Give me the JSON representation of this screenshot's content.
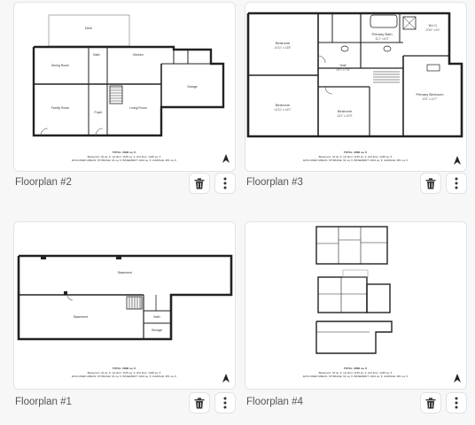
{
  "cards": [
    {
      "caption": "Floorplan #2",
      "plan_labels": [
        "Deck",
        "Dining Room",
        "Kitchen",
        "Bath",
        "Family Room",
        "Foyer",
        "Living Room",
        "Garage"
      ],
      "footer_title": "TOTAL: 2808 sq. ft",
      "footer_lines": [
        "Basement: 44 sq. ft, 1st floor: 1125 sq. ft, 2nd floor: 1235 sq. ft",
        "EXCLUDED AREAS: STORAGE: 61 sq. ft, BASEMENT: 1044 sq. ft, GARAGE: 481 sq. ft"
      ]
    },
    {
      "caption": "Floorplan #3",
      "plan_labels": [
        "Bedroom",
        "Primary Bath",
        "W.I.C.",
        "Hall",
        "Bedroom",
        "Bedroom",
        "Primary Bedroom"
      ],
      "plan_dims": [
        "14'11\" x 13'8\"",
        "11'1\" x 8'3\"",
        "8'10\" x 6'1\"",
        "19'1\" x 7'6\"",
        "14'11\" x 14'0\"",
        "13'1\" x 10'9\"",
        "13'3\" x 21'7\""
      ],
      "footer_title": "TOTAL: 2808 sq. ft",
      "footer_lines": [
        "Basement: 44 sq. ft, 1st floor: 1125 sq. ft, 2nd floor: 1235 sq. ft",
        "EXCLUDED AREAS: STORAGE: 61 sq. ft, BASEMENT: 1044 sq. ft, GARAGE: 481 sq. ft"
      ]
    },
    {
      "caption": "Floorplan #1",
      "plan_labels": [
        "Basement",
        "Basement",
        "Bath",
        "Storage"
      ],
      "footer_title": "TOTAL: 2808 sq. ft",
      "footer_lines": [
        "Basement: 44 sq. ft, 1st floor: 1125 sq. ft, 2nd floor: 1235 sq. ft",
        "EXCLUDED AREAS: STORAGE: 61 sq. ft, BASEMENT: 1044 sq. ft, GARAGE: 481 sq. ft"
      ]
    },
    {
      "caption": "Floorplan #4",
      "footer_title": "TOTAL: 2808 sq. ft",
      "footer_lines": [
        "Basement: 44 sq. ft, 1st floor: 1125 sq. ft, 2nd floor: 1235 sq. ft",
        "EXCLUDED AREAS: STORAGE: 61 sq. ft, BASEMENT: 1044 sq. ft, GARAGE: 481 sq. ft"
      ]
    }
  ],
  "icons": {
    "delete": "trash-icon",
    "more": "more-vertical-icon",
    "north": "north-arrow-icon"
  },
  "colors": {
    "line": "#222222",
    "caption": "#555555"
  }
}
